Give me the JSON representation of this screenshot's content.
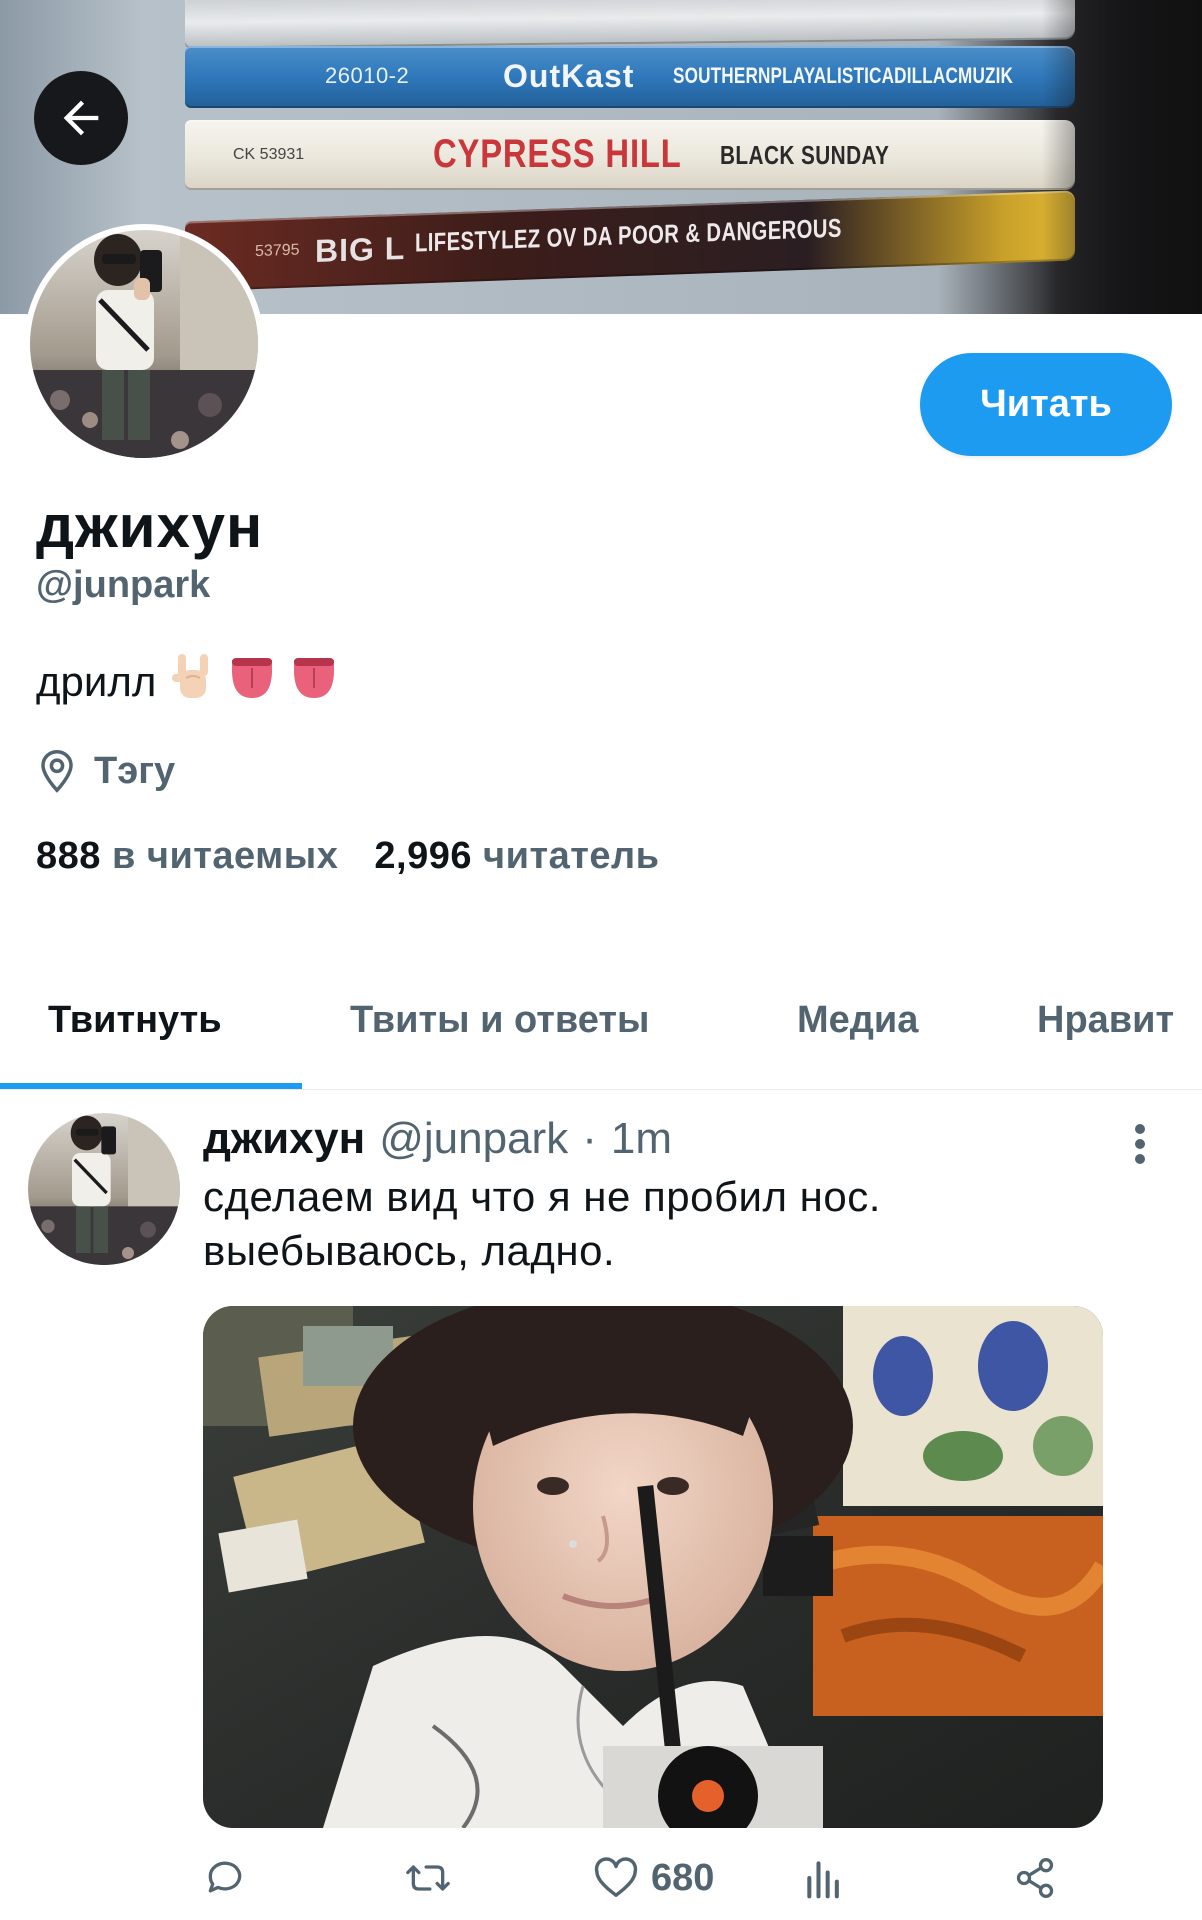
{
  "banner": {
    "cd_texts": {
      "catalog_2": "26010-2",
      "outkast": "OutKast",
      "southern": "SOUTHERNPLAYALISTICADILLACMUZIK",
      "catalog_3": "CK 53931",
      "cypress": "CYPRESS HILL",
      "black_sunday": "BLACK SUNDAY",
      "catalog_4": "53795",
      "bigl": "BIG L",
      "lifestylez": "LIFESTYLEZ OV DA POOR & DANGEROUS"
    }
  },
  "profile": {
    "display_name": "джихун",
    "handle": "@junpark",
    "bio_text": "дрилл",
    "bio_emojis": [
      "🤘🏻",
      "👅",
      "👅"
    ],
    "location": "Тэгу",
    "following_count": "888",
    "following_label": "в читаемых",
    "followers_count": "2,996",
    "followers_label": "читатель"
  },
  "header": {
    "follow_label": "Читать"
  },
  "tabs": [
    {
      "label": "Твитнуть",
      "active": true
    },
    {
      "label": "Твиты и ответы",
      "active": false
    },
    {
      "label": "Медиа",
      "active": false
    },
    {
      "label": "Нравит",
      "active": false
    }
  ],
  "tweet": {
    "author_name": "джихун",
    "author_handle": "@junpark",
    "separator": "·",
    "time": "1m",
    "text_lines": [
      "сделаем вид что я не пробил нос.",
      "выебываюсь, ладно."
    ],
    "likes": "680"
  },
  "colors": {
    "accent": "#1d9bf0",
    "text_primary": "#0f1419",
    "text_secondary": "#536471"
  },
  "icons": {
    "back": "arrow-left-icon",
    "location": "location-pin-icon",
    "more": "more-vertical-icon",
    "reply": "reply-icon",
    "retweet": "retweet-icon",
    "like": "heart-icon",
    "views": "analytics-icon",
    "share": "share-icon"
  }
}
